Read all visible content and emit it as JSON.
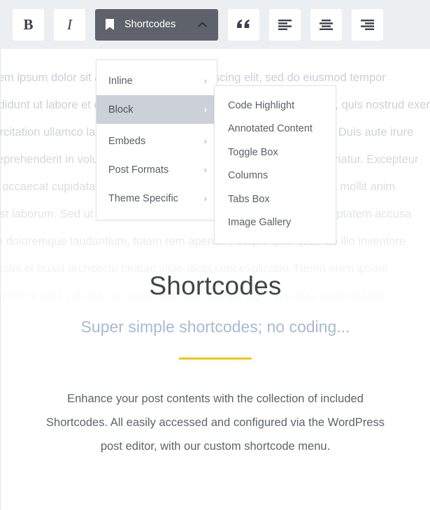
{
  "toolbar": {
    "bold_label": "B",
    "italic_label": "I",
    "shortcodes_label": "Shortcodes",
    "icons": {
      "bookmark": "bookmark-icon",
      "chevron_up": "chevron-up-icon",
      "quote": "quote-icon",
      "align_left": "align-left-icon",
      "align_center": "align-center-icon",
      "align_right": "align-right-icon"
    }
  },
  "menu": {
    "items": [
      {
        "label": "Inline",
        "has_submenu": true,
        "active": false
      },
      {
        "label": "Block",
        "has_submenu": true,
        "active": true
      },
      {
        "label": "Embeds",
        "has_submenu": true,
        "active": false
      },
      {
        "label": "Post Formats",
        "has_submenu": true,
        "active": false
      },
      {
        "label": "Theme Specific",
        "has_submenu": true,
        "active": false
      }
    ],
    "submenu": {
      "parent": "Block",
      "items": [
        {
          "label": "Code Highlight"
        },
        {
          "label": "Annotated Content"
        },
        {
          "label": "Toggle Box"
        },
        {
          "label": "Columns"
        },
        {
          "label": "Tabs Box"
        },
        {
          "label": "Image Gallery"
        }
      ]
    },
    "chevron_right": "›"
  },
  "hero": {
    "title": "Shortcodes",
    "subtitle": "Super simple shortcodes; no coding...",
    "body": "Enhance your post contents with the collection of included Shortcodes. All easily accessed and configured via the WordPress post editor, with our custom shortcode menu."
  },
  "background_text": {
    "lines": [
      "Lorem ipsum dolor sit amet, consectetur adipiscing elit, sed do eiusmod tempor",
      "incididunt ut labore et dolore magna aliqua. Ut enim ad minim veniam, quis nostrud exerc",
      "exercitation ullamco laboris nisi ut aliquip ex ea commodo consequat. Duis aute irure",
      "in reprehenderit in voluptate velit esse cillum dolore eu fugiat nulla pariatur. Excepteur",
      "sint occaecat cupidatat non proident, sunt in culpa qui officia deserunt mollit anim",
      "id est laborum. Sed ut perspiciatis unde omnis iste natus error sit voluptatem accusa",
      "tium doloremque laudantium, totam rem aperiam, eaque ipsa quae ab illo inventore",
      "veritatis et quasi architecto beatae vitae dicta sunt explicabo. Nemo enim ipsam",
      "voluptatem quia voluptas sit aspernatur aut odit aut fugit, sed quia consequuntur"
    ]
  },
  "colors": {
    "toolbar_bg": "#eceff1",
    "button_active_bg": "#5d626b",
    "menu_highlight": "#ccd1d9",
    "accent_rule": "#f5c518",
    "subtitle": "#a9bacd",
    "body_text": "#5d646d"
  }
}
